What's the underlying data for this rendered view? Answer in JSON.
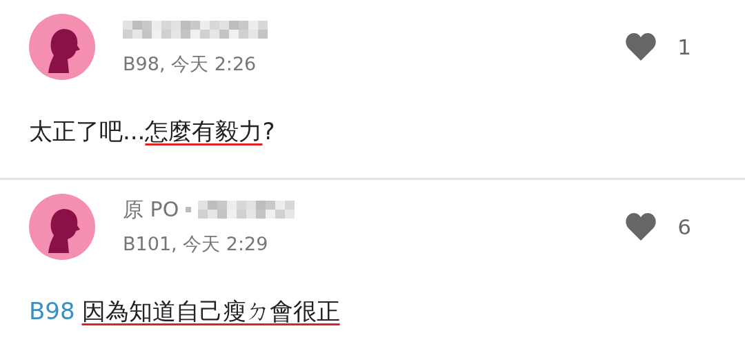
{
  "comments": [
    {
      "meta": "B98, 今天 2:26",
      "likes": "1",
      "body": [
        {
          "text": "太正了吧...",
          "underlined": false
        },
        {
          "text": "怎麼有毅力",
          "underlined": true
        },
        {
          "text": "?",
          "underlined": false
        }
      ]
    },
    {
      "author_prefix": "原 PO",
      "meta": "B101, 今天 2:29",
      "likes": "6",
      "body": [
        {
          "text": "因為知道自己瘦ㄉ會很正",
          "underlined": true
        }
      ],
      "reply_to": "B98"
    }
  ]
}
